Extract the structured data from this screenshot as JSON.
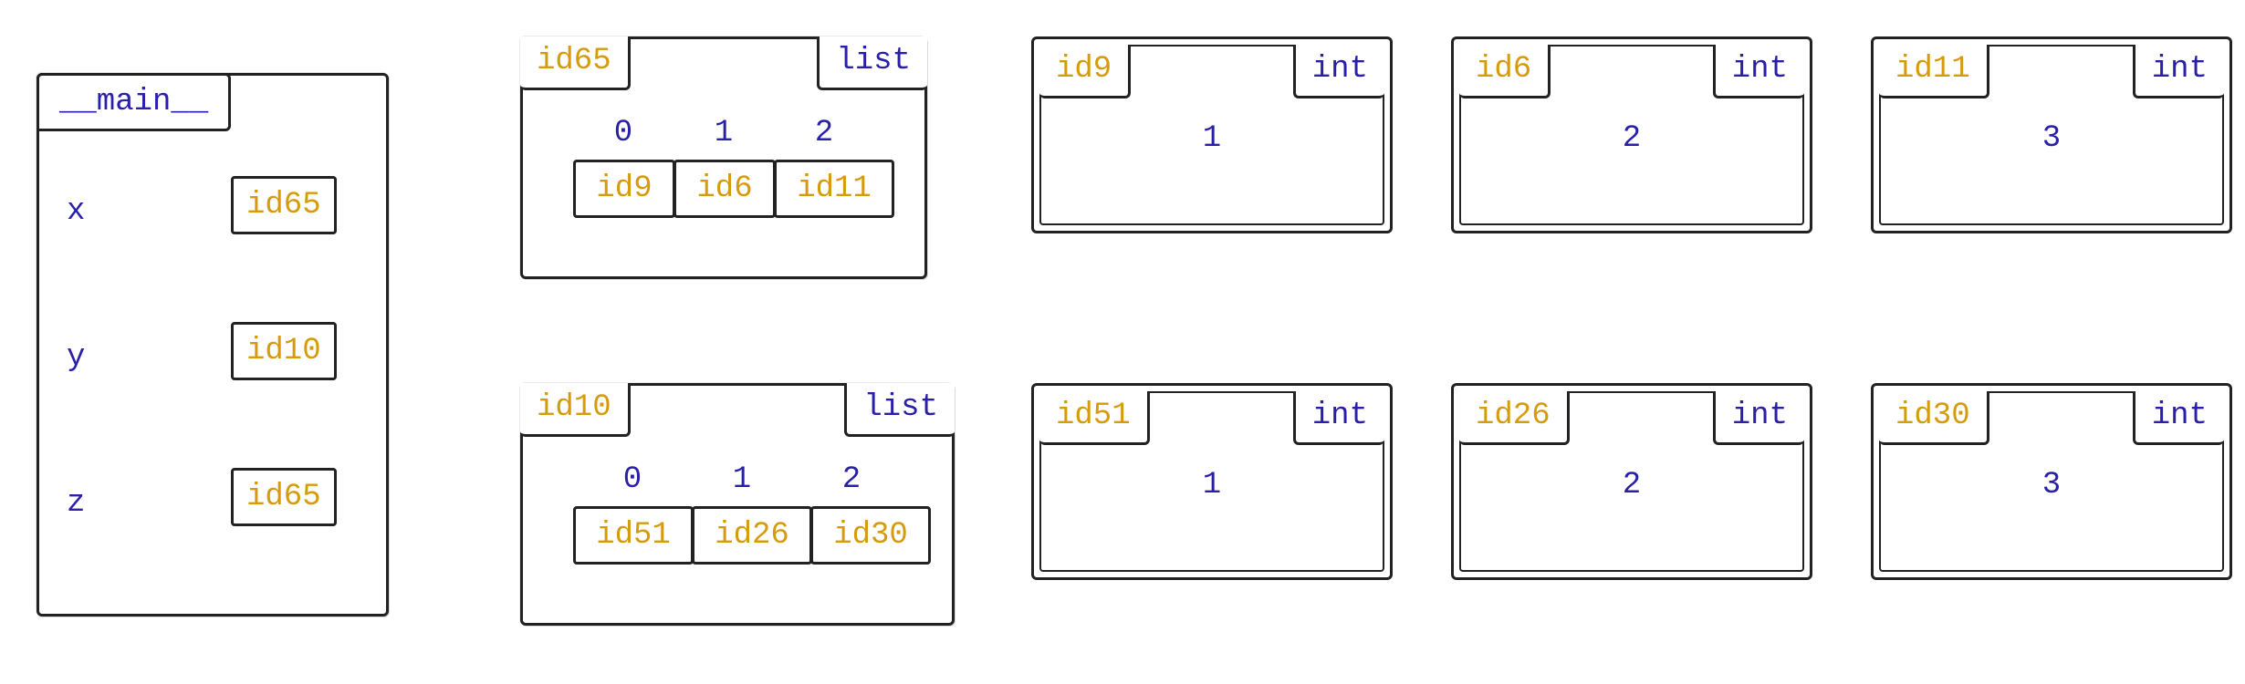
{
  "frame": {
    "title": "__main__",
    "vars": [
      {
        "name": "x",
        "ref": "id65"
      },
      {
        "name": "y",
        "ref": "id10"
      },
      {
        "name": "z",
        "ref": "id65"
      }
    ]
  },
  "lists": [
    {
      "id": "id65",
      "type": "list",
      "indices": [
        "0",
        "1",
        "2"
      ],
      "refs": [
        "id9",
        "id6",
        "id11"
      ]
    },
    {
      "id": "id10",
      "type": "list",
      "indices": [
        "0",
        "1",
        "2"
      ],
      "refs": [
        "id51",
        "id26",
        "id30"
      ]
    }
  ],
  "ints_row1": [
    {
      "id": "id9",
      "type": "int",
      "value": "1"
    },
    {
      "id": "id6",
      "type": "int",
      "value": "2"
    },
    {
      "id": "id11",
      "type": "int",
      "value": "3"
    }
  ],
  "ints_row2": [
    {
      "id": "id51",
      "type": "int",
      "value": "1"
    },
    {
      "id": "id26",
      "type": "int",
      "value": "2"
    },
    {
      "id": "id30",
      "type": "int",
      "value": "3"
    }
  ]
}
